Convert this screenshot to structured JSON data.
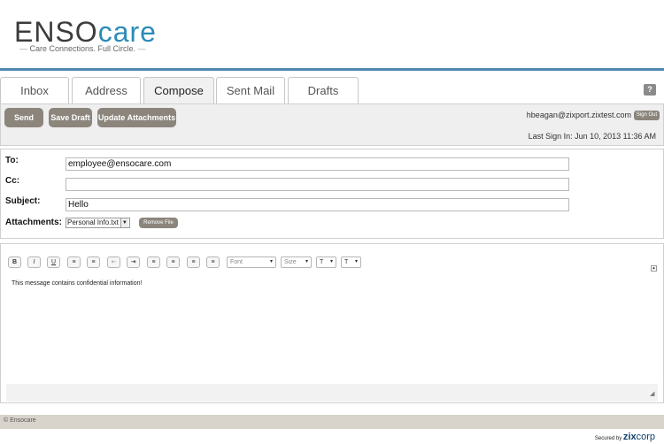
{
  "brand": {
    "logo_part1": "ENSO",
    "logo_part2": "care",
    "tagline": "Care Connections. Full Circle.",
    "accent_color": "#2c8bb8"
  },
  "tabs": [
    {
      "label": "Inbox",
      "active": false
    },
    {
      "label": "Address",
      "active": false
    },
    {
      "label": "Compose",
      "active": true
    },
    {
      "label": "Sent Mail",
      "active": false
    },
    {
      "label": "Drafts",
      "active": false
    }
  ],
  "help_label": "?",
  "toolbar": {
    "send_label": "Send",
    "save_draft_label": "Save Draft",
    "update_attachments_label": "Update Attachments",
    "user_email": "hbeagan@zixport.zixtest.com",
    "sign_out_label": "Sign Out",
    "last_sign_in": "Last Sign In: Jun 10, 2013 11:36 AM"
  },
  "compose": {
    "to_label": "To:",
    "to_value": "employee@ensocare.com",
    "cc_label": "Cc:",
    "cc_value": "",
    "subject_label": "Subject:",
    "subject_value": "Hello",
    "attachments_label": "Attachments:",
    "attachment_selected": "Personal Info.txt",
    "remove_file_label": "Remove File"
  },
  "editor": {
    "toolbar": {
      "bold": "B",
      "italic": "I",
      "underline": "U",
      "font_placeholder": "Font",
      "size_placeholder": "Size"
    },
    "body_text": "This message contains confidential information!"
  },
  "footer": {
    "copyright": "© Ensocare",
    "secured_by": "Secured by",
    "zix": "zix",
    "corp": "corp"
  }
}
